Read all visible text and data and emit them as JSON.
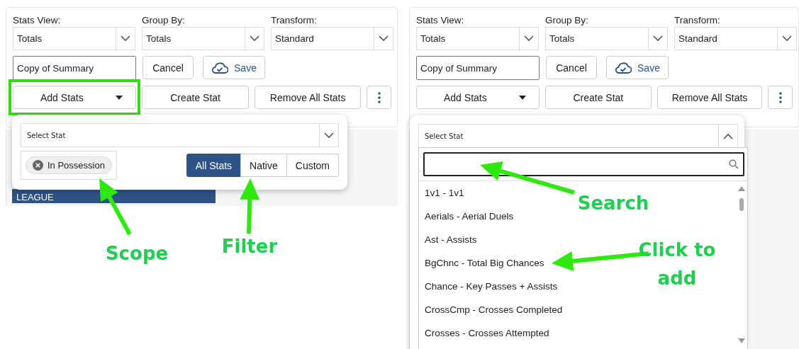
{
  "panels": [
    {
      "selects": [
        {
          "label": "Stats View:",
          "value": "Totals"
        },
        {
          "label": "Group By:",
          "value": "Totals"
        },
        {
          "label": "Transform:",
          "value": "Standard"
        }
      ],
      "name_input": {
        "value": "Copy of Summary"
      },
      "cancel": "Cancel",
      "save": "Save",
      "add_stats": "Add Stats",
      "add_stats_highlighted": true,
      "create_stat": "Create Stat",
      "remove_all": "Remove All Stats",
      "dropdown": {
        "placeholder": "Select Stat",
        "expanded": false,
        "scope_chip": "In Possession",
        "filters": [
          {
            "label": "All Stats",
            "selected": true
          },
          {
            "label": "Native",
            "selected": false
          },
          {
            "label": "Custom",
            "selected": false
          }
        ]
      },
      "background_header": "LEAGUE"
    },
    {
      "selects": [
        {
          "label": "Stats View:",
          "value": "Totals"
        },
        {
          "label": "Group By:",
          "value": "Totals"
        },
        {
          "label": "Transform:",
          "value": "Standard"
        }
      ],
      "name_input": {
        "value": "Copy of Summary"
      },
      "cancel": "Cancel",
      "save": "Save",
      "add_stats": "Add Stats",
      "add_stats_highlighted": false,
      "create_stat": "Create Stat",
      "remove_all": "Remove All Stats",
      "dropdown": {
        "placeholder": "Select Stat",
        "expanded": true,
        "options": [
          "1v1 - 1v1",
          "Aerials - Aerial Duels",
          "Ast - Assists",
          "BgChnc - Total Big Chances",
          "Chance - Key Passes + Assists",
          "CrossCmp - Crosses Completed",
          "Crosses - Crosses Attempted"
        ]
      }
    }
  ],
  "annotations": [
    {
      "text": "Scope"
    },
    {
      "text": "Filter"
    },
    {
      "text": "Search"
    },
    {
      "text": "Click to add"
    }
  ]
}
